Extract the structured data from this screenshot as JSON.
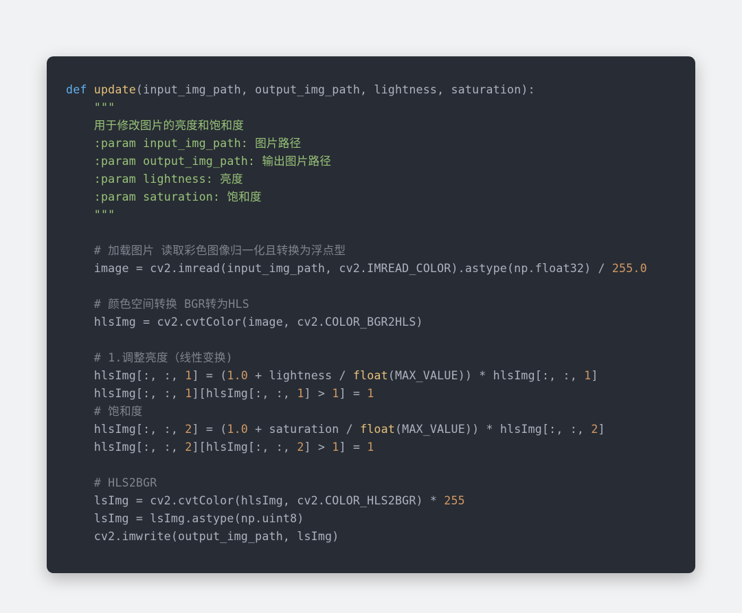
{
  "code": {
    "lines": [
      [
        {
          "cls": "kw",
          "t": "def "
        },
        {
          "cls": "fn",
          "t": "update"
        },
        {
          "cls": "sym",
          "t": "("
        },
        {
          "cls": "pr",
          "t": "input_img_path, output_img_path, lightness, saturation"
        },
        {
          "cls": "sym",
          "t": ")"
        },
        {
          "cls": "sym",
          "t": ":"
        }
      ],
      [
        {
          "cls": "pr",
          "t": "    "
        },
        {
          "cls": "str",
          "t": "\"\"\""
        }
      ],
      [
        {
          "cls": "str",
          "t": "    用于修改图片的亮度和饱和度"
        }
      ],
      [
        {
          "cls": "str",
          "t": "    :param input_img_path: 图片路径"
        }
      ],
      [
        {
          "cls": "str",
          "t": "    :param output_img_path: 输出图片路径"
        }
      ],
      [
        {
          "cls": "str",
          "t": "    :param lightness: 亮度"
        }
      ],
      [
        {
          "cls": "str",
          "t": "    :param saturation: 饱和度"
        }
      ],
      [
        {
          "cls": "str",
          "t": "    \"\"\""
        }
      ],
      [
        {
          "cls": "pr",
          "t": ""
        }
      ],
      [
        {
          "cls": "pr",
          "t": "    "
        },
        {
          "cls": "cmt",
          "t": "# 加载图片 读取彩色图像归一化且转换为浮点型"
        }
      ],
      [
        {
          "cls": "pr",
          "t": "    image = cv2.imread(input_img_path, cv2.IMREAD_COLOR).astype(np.float32) / "
        },
        {
          "cls": "num",
          "t": "255.0"
        }
      ],
      [
        {
          "cls": "pr",
          "t": ""
        }
      ],
      [
        {
          "cls": "pr",
          "t": "    "
        },
        {
          "cls": "cmt",
          "t": "# 颜色空间转换 BGR转为HLS"
        }
      ],
      [
        {
          "cls": "pr",
          "t": "    hlsImg = cv2.cvtColor(image, cv2.COLOR_BGR2HLS)"
        }
      ],
      [
        {
          "cls": "pr",
          "t": ""
        }
      ],
      [
        {
          "cls": "pr",
          "t": "    "
        },
        {
          "cls": "cmt",
          "t": "# 1.调整亮度（线性变换)"
        }
      ],
      [
        {
          "cls": "pr",
          "t": "    hlsImg[:, :, "
        },
        {
          "cls": "num",
          "t": "1"
        },
        {
          "cls": "pr",
          "t": "] = ("
        },
        {
          "cls": "num",
          "t": "1.0"
        },
        {
          "cls": "pr",
          "t": " + lightness / "
        },
        {
          "cls": "fn",
          "t": "float"
        },
        {
          "cls": "pr",
          "t": "(MAX_VALUE)) * hlsImg[:, :, "
        },
        {
          "cls": "num",
          "t": "1"
        },
        {
          "cls": "pr",
          "t": "]"
        }
      ],
      [
        {
          "cls": "pr",
          "t": "    hlsImg[:, :, "
        },
        {
          "cls": "num",
          "t": "1"
        },
        {
          "cls": "pr",
          "t": "][hlsImg[:, :, "
        },
        {
          "cls": "num",
          "t": "1"
        },
        {
          "cls": "pr",
          "t": "] > "
        },
        {
          "cls": "num",
          "t": "1"
        },
        {
          "cls": "pr",
          "t": "] = "
        },
        {
          "cls": "num",
          "t": "1"
        }
      ],
      [
        {
          "cls": "pr",
          "t": "    "
        },
        {
          "cls": "cmt",
          "t": "# 饱和度"
        }
      ],
      [
        {
          "cls": "pr",
          "t": "    hlsImg[:, :, "
        },
        {
          "cls": "num",
          "t": "2"
        },
        {
          "cls": "pr",
          "t": "] = ("
        },
        {
          "cls": "num",
          "t": "1.0"
        },
        {
          "cls": "pr",
          "t": " + saturation / "
        },
        {
          "cls": "fn",
          "t": "float"
        },
        {
          "cls": "pr",
          "t": "(MAX_VALUE)) * hlsImg[:, :, "
        },
        {
          "cls": "num",
          "t": "2"
        },
        {
          "cls": "pr",
          "t": "]"
        }
      ],
      [
        {
          "cls": "pr",
          "t": "    hlsImg[:, :, "
        },
        {
          "cls": "num",
          "t": "2"
        },
        {
          "cls": "pr",
          "t": "][hlsImg[:, :, "
        },
        {
          "cls": "num",
          "t": "2"
        },
        {
          "cls": "pr",
          "t": "] > "
        },
        {
          "cls": "num",
          "t": "1"
        },
        {
          "cls": "pr",
          "t": "] = "
        },
        {
          "cls": "num",
          "t": "1"
        }
      ],
      [
        {
          "cls": "pr",
          "t": ""
        }
      ],
      [
        {
          "cls": "pr",
          "t": "    "
        },
        {
          "cls": "cmt",
          "t": "# HLS2BGR"
        }
      ],
      [
        {
          "cls": "pr",
          "t": "    lsImg = cv2.cvtColor(hlsImg, cv2.COLOR_HLS2BGR) * "
        },
        {
          "cls": "num",
          "t": "255"
        }
      ],
      [
        {
          "cls": "pr",
          "t": "    lsImg = lsImg.astype(np.uint8)"
        }
      ],
      [
        {
          "cls": "pr",
          "t": "    cv2.imwrite(output_img_path, lsImg)"
        }
      ]
    ]
  }
}
